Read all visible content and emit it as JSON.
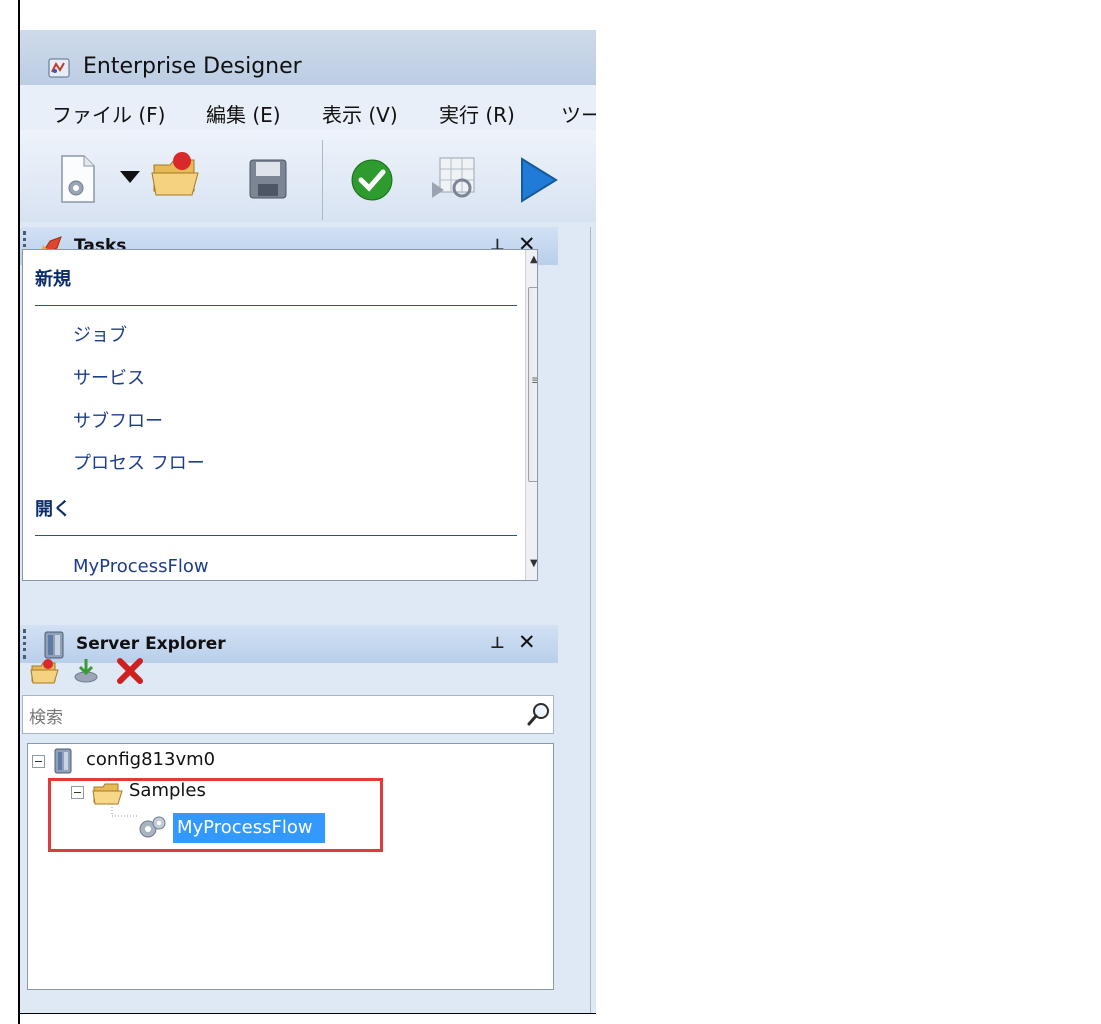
{
  "window": {
    "title": "Enterprise Designer"
  },
  "menu": [
    {
      "label": "ファイル (F)"
    },
    {
      "label": "編集 (E)"
    },
    {
      "label": "表示 (V)"
    },
    {
      "label": "実行 (R)"
    },
    {
      "label": "ツー"
    }
  ],
  "toolbar": {
    "icons": [
      "new-document-icon",
      "dropdown-arrow-icon",
      "open-folder-icon",
      "save-icon",
      "validate-check-icon",
      "inspect-grid-icon",
      "run-play-icon"
    ]
  },
  "tasks": {
    "title": "Tasks",
    "new_section": "新規",
    "new_items": [
      "ジョブ",
      "サービス",
      "サブフロー",
      "プロセス フロー"
    ],
    "open_section": "開く",
    "open_items": [
      "MyProcessFlow"
    ]
  },
  "server_explorer": {
    "title": "Server Explorer",
    "search_placeholder": "検索",
    "tree": {
      "server": "config813vm0",
      "folder": "Samples",
      "item": "MyProcessFlow"
    }
  },
  "colors": {
    "selection": "#3399ff",
    "highlight_border": "#e0393e",
    "panel_header": "#c6d8ef"
  }
}
